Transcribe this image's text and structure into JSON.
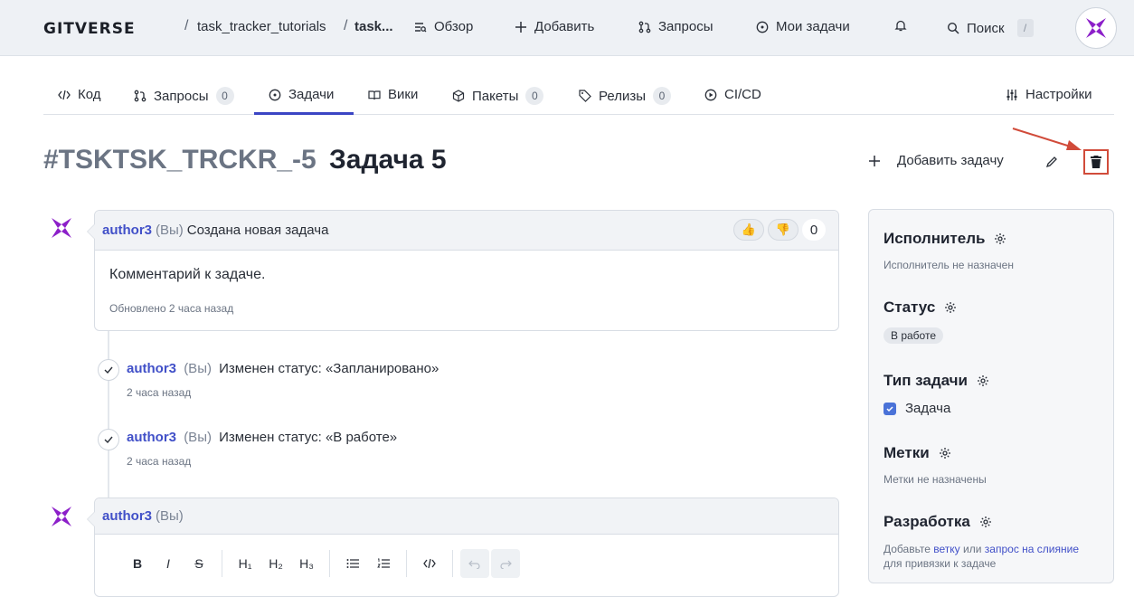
{
  "header": {
    "logo": "GITVERSE",
    "breadcrumb": [
      "task_tracker_tutorials",
      "task..."
    ],
    "breadcrumb_sep": "/",
    "nav": {
      "overview": "Обзор",
      "add": "Добавить",
      "requests": "Запросы",
      "my_tasks": "Мои задачи",
      "search": "Поиск",
      "search_shortcut": "/"
    }
  },
  "tabs": [
    {
      "label": "Код",
      "icon": "code-icon"
    },
    {
      "label": "Запросы",
      "icon": "pull-request-icon",
      "count": "0"
    },
    {
      "label": "Задачи",
      "icon": "issue-icon",
      "active": true
    },
    {
      "label": "Вики",
      "icon": "book-icon"
    },
    {
      "label": "Пакеты",
      "icon": "package-icon",
      "count": "0"
    },
    {
      "label": "Релизы",
      "icon": "tag-icon",
      "count": "0"
    },
    {
      "label": "CI/CD",
      "icon": "play-icon"
    }
  ],
  "settings_tab": "Настройки",
  "issue": {
    "id_prefix": "#TSKTSK_TRCKR_-5",
    "title": "Задача 5",
    "add_task_label": "Добавить задачу"
  },
  "comment": {
    "author": "author3",
    "you": "(Вы)",
    "action": "Создана новая задача",
    "body": "Комментарий к задаче.",
    "updated": "Обновлено 2 часа назад",
    "reaction_count": "0"
  },
  "events": [
    {
      "author": "author3",
      "you": "(Вы)",
      "action": "Изменен статус: «Запланировано»",
      "time": "2 часа назад"
    },
    {
      "author": "author3",
      "you": "(Вы)",
      "action": "Изменен статус: «В работе»",
      "time": "2 часа назад"
    }
  ],
  "editor": {
    "author": "author3",
    "you": "(Вы)",
    "toolbar": {
      "bold": "B",
      "italic": "I",
      "strike": "S",
      "h1": "H₁",
      "h2": "H₂",
      "h3": "H₃"
    }
  },
  "sidebar": {
    "assignee": {
      "title": "Исполнитель",
      "value": "Исполнитель не назначен"
    },
    "status": {
      "title": "Статус",
      "value": "В работе"
    },
    "type": {
      "title": "Тип задачи",
      "value": "Задача"
    },
    "labels": {
      "title": "Метки",
      "value": "Метки не назначены"
    },
    "dev": {
      "title": "Разработка",
      "prefix": "Добавьте",
      "branch": "ветку",
      "or": "или",
      "mr": "запрос на слияние",
      "suffix": "для привязки к задаче"
    }
  },
  "colors": {
    "accent": "#3b45c4",
    "link": "#4150c8",
    "annotation": "#d14b3a"
  }
}
